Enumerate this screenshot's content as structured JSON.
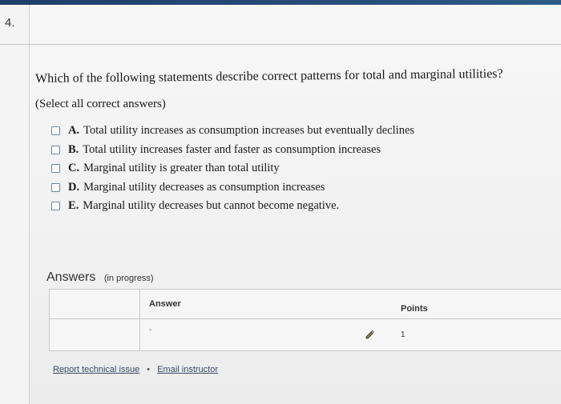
{
  "question": {
    "number": "4.",
    "text": "Which of the following statements describe correct patterns for total and marginal utilities?",
    "instruction": "(Select all correct answers)",
    "options": [
      {
        "letter": "A.",
        "text": "Total utility increases as consumption increases but eventually declines"
      },
      {
        "letter": "B.",
        "text": "Total utility increases faster and faster as consumption increases"
      },
      {
        "letter": "C.",
        "text": "Marginal utility is greater than total utility"
      },
      {
        "letter": "D.",
        "text": "Marginal utility decreases as consumption increases"
      },
      {
        "letter": "E.",
        "text": "Marginal utility decreases but cannot become negative."
      }
    ]
  },
  "answers": {
    "title": "Answers",
    "status": "(in progress)",
    "columns": {
      "answer": "Answer",
      "points": "Points"
    },
    "rows": [
      {
        "answer": "-",
        "points": "1"
      }
    ]
  },
  "footer": {
    "report_link": "Report technical issue",
    "separator": "•",
    "email_link": "Email instructor"
  },
  "colors": {
    "top_band": "#1e3e6a",
    "checkbox_border": "#6d86a8",
    "link": "#3a4a66"
  }
}
